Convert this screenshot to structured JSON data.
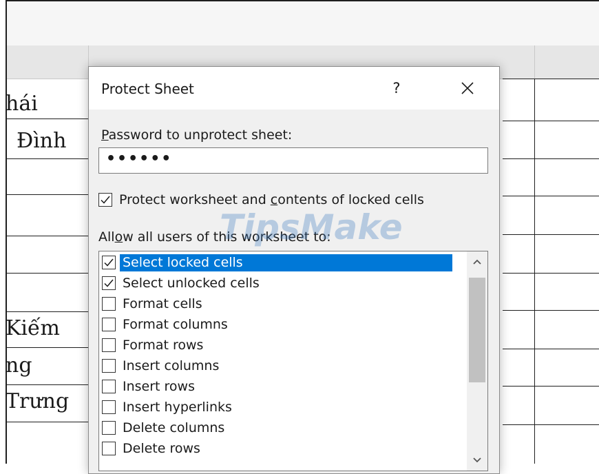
{
  "sheet": {
    "cells": [
      "hái",
      "Đình",
      "Kiếm",
      "ng",
      "Trưng"
    ]
  },
  "dialog": {
    "title": "Protect Sheet",
    "help_label": "?",
    "password": {
      "label_accel": "P",
      "label_rest": "assword to unprotect sheet:",
      "value": "••••••"
    },
    "protect_checkbox": {
      "label_before": "Protect worksheet and ",
      "label_accel": "c",
      "label_after": "ontents of locked cells",
      "checked": true
    },
    "allow": {
      "label_before": "All",
      "label_accel": "o",
      "label_after": "w all users of this worksheet to:"
    },
    "watermark": "TipsMake",
    "permissions": [
      {
        "label": "Select locked cells",
        "checked": true,
        "selected": true
      },
      {
        "label": "Select unlocked cells",
        "checked": true,
        "selected": false
      },
      {
        "label": "Format cells",
        "checked": false,
        "selected": false
      },
      {
        "label": "Format columns",
        "checked": false,
        "selected": false
      },
      {
        "label": "Format rows",
        "checked": false,
        "selected": false
      },
      {
        "label": "Insert columns",
        "checked": false,
        "selected": false
      },
      {
        "label": "Insert rows",
        "checked": false,
        "selected": false
      },
      {
        "label": "Insert hyperlinks",
        "checked": false,
        "selected": false
      },
      {
        "label": "Delete columns",
        "checked": false,
        "selected": false
      },
      {
        "label": "Delete rows",
        "checked": false,
        "selected": false
      }
    ],
    "icons": {
      "close": "close-icon",
      "checkmark": "checkmark-icon",
      "scroll_up": "chevron-up-icon",
      "scroll_down": "chevron-down-icon"
    }
  },
  "colors": {
    "selection": "#0078d7",
    "dialog_bg": "#f0f0f0",
    "header_bg": "#e6e6e6"
  }
}
